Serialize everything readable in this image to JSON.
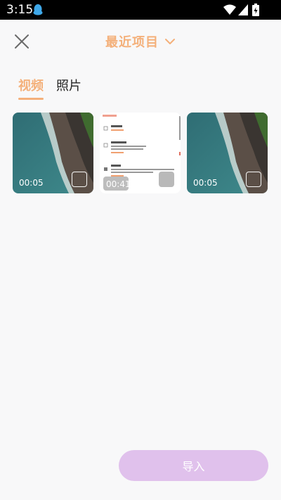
{
  "status_bar": {
    "time": "3:15"
  },
  "header": {
    "title": "最近项目"
  },
  "tabs": [
    {
      "label": "视频",
      "active": true
    },
    {
      "label": "照片",
      "active": false
    }
  ],
  "media": [
    {
      "duration": "00:05",
      "kind": "beach-video"
    },
    {
      "duration": "00:41",
      "kind": "settings-screenshot"
    },
    {
      "duration": "00:05",
      "kind": "beach-video"
    }
  ],
  "footer": {
    "import_label": "导入"
  },
  "colors": {
    "accent": "#f4b07a",
    "import_button": "#e0c1ec",
    "background": "#f8f8f9"
  }
}
